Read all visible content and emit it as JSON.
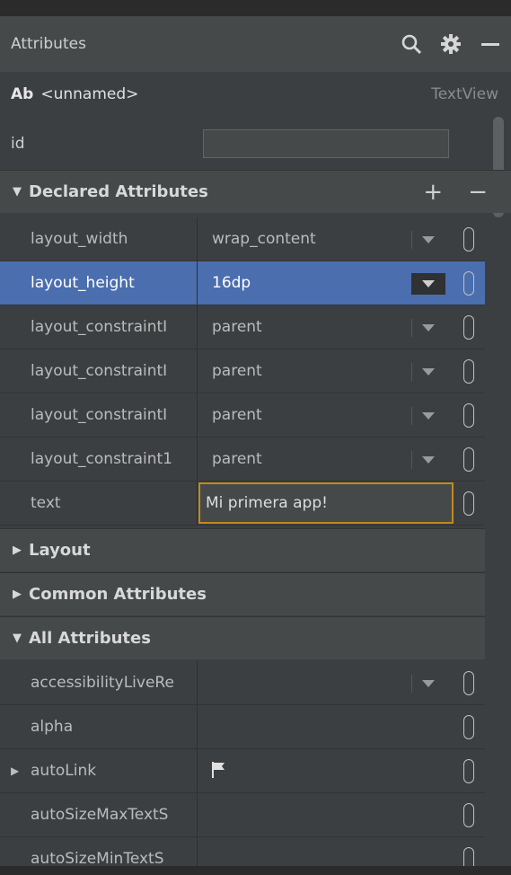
{
  "header": {
    "title": "Attributes",
    "icons": [
      "search-icon",
      "gear-icon",
      "minimize-icon"
    ]
  },
  "selected_view": {
    "icon_text": "Ab",
    "name": "<unnamed>",
    "class": "TextView"
  },
  "id_field": {
    "label": "id",
    "value": ""
  },
  "sections": {
    "declared": {
      "label": "Declared Attributes",
      "expanded": true,
      "add": "+",
      "remove": "−"
    },
    "layout": {
      "label": "Layout",
      "expanded": false
    },
    "common": {
      "label": "Common Attributes",
      "expanded": false
    },
    "all": {
      "label": "All Attributes",
      "expanded": true
    }
  },
  "declared_rows": [
    {
      "name": "layout_width",
      "value": "wrap_content"
    },
    {
      "name": "layout_height",
      "value": "16dp"
    },
    {
      "name": "layout_constraintI",
      "value": "parent"
    },
    {
      "name": "layout_constraintI",
      "value": "parent"
    },
    {
      "name": "layout_constraintI",
      "value": "parent"
    },
    {
      "name": "layout_constraint1",
      "value": "parent"
    },
    {
      "name": "text",
      "value": "Mi primera app!"
    }
  ],
  "all_rows": [
    {
      "name": "accessibilityLiveRe",
      "value": ""
    },
    {
      "name": "alpha",
      "value": ""
    },
    {
      "name": "autoLink",
      "value": ""
    },
    {
      "name": "autoSizeMaxTextS",
      "value": ""
    },
    {
      "name": "autoSizeMinTextS",
      "value": ""
    }
  ],
  "colors": {
    "selection": "#4b6eaf",
    "focus_border": "#c2891b",
    "panel_bg": "#3c3f41",
    "header_bg": "#45494a"
  }
}
